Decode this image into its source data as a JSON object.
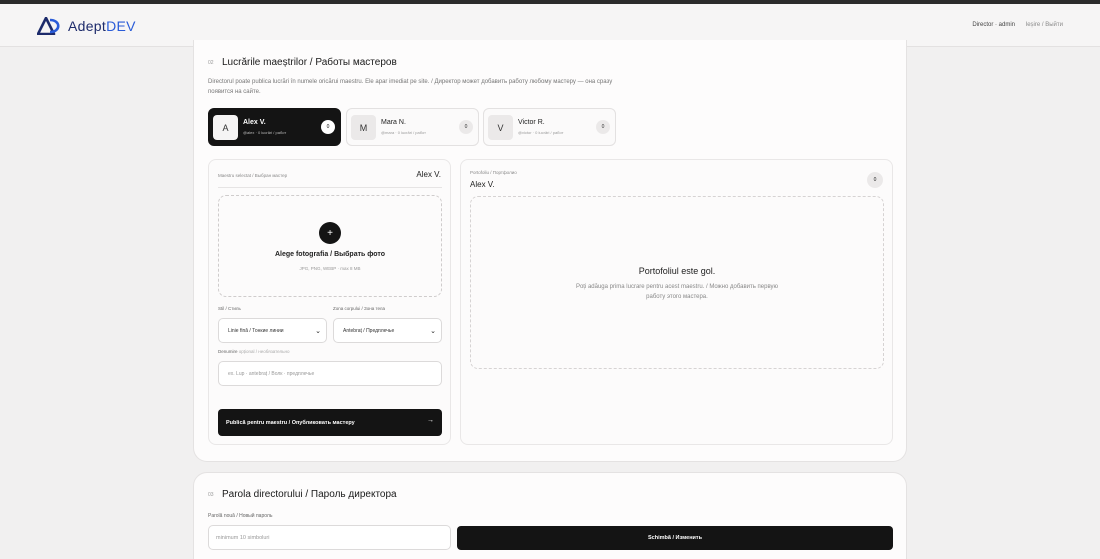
{
  "header": {
    "logo_text_a": "Adept",
    "logo_text_b": "DEV",
    "user_label": "Director · admin",
    "logout_label": "Ieșire / Выйти"
  },
  "works": {
    "number": "02",
    "title": "Lucrările maeștrilor / Работы мастеров",
    "description": "Directorul poate publica lucrări în numele oricărui maestru. Ele apar imediat pe site. / Директор может добавить работу любому мастеру — она сразу появится на сайте.",
    "masters": [
      {
        "initial": "A",
        "name": "Alex V.",
        "meta": "@alex · 0 lucrări / работ",
        "count": "0",
        "active": true
      },
      {
        "initial": "M",
        "name": "Mara N.",
        "meta": "@mara · 0 lucrări / работ",
        "count": "0",
        "active": false
      },
      {
        "initial": "V",
        "name": "Victor R.",
        "meta": "@victor · 0 lucrări / работ",
        "count": "0",
        "active": false
      }
    ],
    "form": {
      "selected_label": "Maestru selectat / Выбран мастер",
      "selected_name": "Alex V.",
      "upload_title": "Alege fotografia / Выбрать фото",
      "upload_sub": "JPG, PNG, WEBP · max 8 MB",
      "style_label": "Stil / Стиль",
      "style_value": "Linie fină / Тонкие линии",
      "zone_label": "Zona corpului / Зона тела",
      "zone_value": "Antebraț / Предплечье",
      "name_label": "Denumire",
      "name_optional": "opțional / необязательно",
      "name_placeholder": "ex. Lup · antebraț / Волк · предплечье",
      "publish_label": "Publică pentru maestru / Опубликовать мастеру"
    },
    "portfolio": {
      "label": "Portofoliu / Портфолио",
      "name": "Alex V.",
      "count": "0",
      "empty_title": "Portofoliul este gol.",
      "empty_sub": "Poți adăuga prima lucrare pentru acest maestru. / Можно добавить первую работу этого мастера."
    }
  },
  "password": {
    "number": "03",
    "title": "Parola directorului / Пароль директора",
    "field_label": "Parolă nouă / Новый пароль",
    "placeholder": "minimum 10 simboluri",
    "button_label": "Schimbă / Изменить"
  },
  "colors": {
    "logo_primary": "#1d2b6b",
    "logo_accent": "#2a5cd8",
    "dark": "#141414"
  }
}
